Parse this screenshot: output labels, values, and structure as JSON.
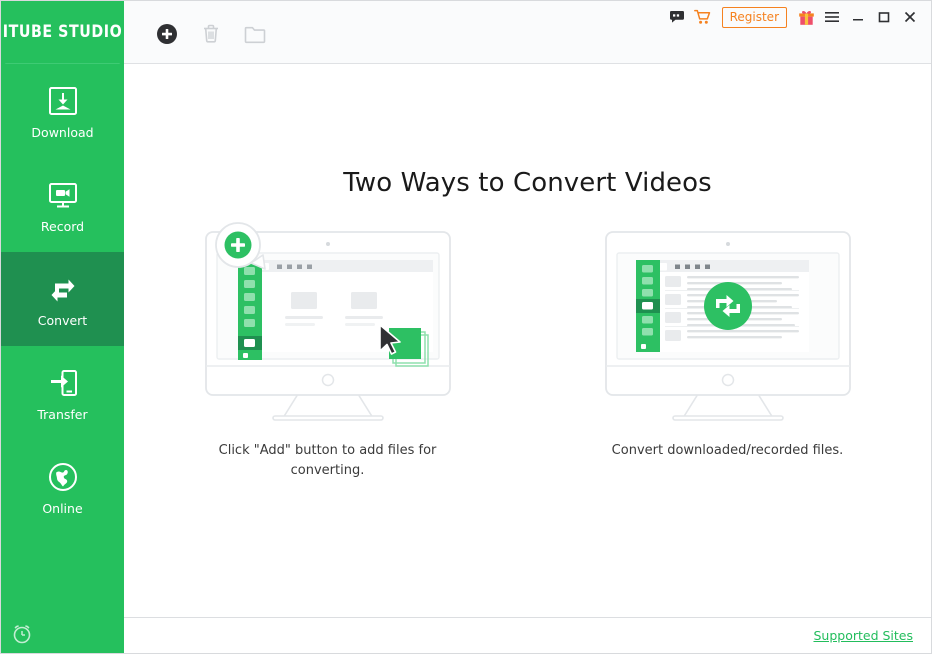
{
  "app": {
    "logo_text": "ITUBE STUDIO",
    "accent_green": "#25c05d",
    "active_green": "#1f9050",
    "orange": "#f58220",
    "link_green": "#22bd5c"
  },
  "sidebar": {
    "items": [
      {
        "label": "Download",
        "icon": "download-icon",
        "active": false
      },
      {
        "label": "Record",
        "icon": "record-icon",
        "active": false
      },
      {
        "label": "Convert",
        "icon": "convert-icon",
        "active": true
      },
      {
        "label": "Transfer",
        "icon": "transfer-icon",
        "active": false
      },
      {
        "label": "Online",
        "icon": "globe-icon",
        "active": false
      }
    ],
    "bottom_icon": "alarm-clock-icon"
  },
  "toolbar": {
    "buttons": [
      {
        "name": "add-button",
        "icon": "plus-circle-icon",
        "enabled": true
      },
      {
        "name": "delete-button",
        "icon": "trash-icon",
        "enabled": false
      },
      {
        "name": "folder-button",
        "icon": "folder-icon",
        "enabled": false
      }
    ]
  },
  "titlebar": {
    "feedback_icon": "feedback-icon",
    "cart_icon": "shopping-cart-icon",
    "register_label": "Register",
    "gift_icon": "gift-icon",
    "menu_icon": "hamburger-menu-icon",
    "minimize_icon": "minimize-icon",
    "maximize_icon": "maximize-icon",
    "close_icon": "close-icon"
  },
  "main": {
    "headline": "Two Ways to Convert Videos",
    "panels": [
      {
        "art": "monitor-add-files-illustration",
        "caption": "Click \"Add\" button to add files for converting."
      },
      {
        "art": "monitor-convert-list-illustration",
        "caption": "Convert downloaded/recorded files."
      }
    ]
  },
  "statusbar": {
    "supported_sites_label": "Supported Sites"
  }
}
